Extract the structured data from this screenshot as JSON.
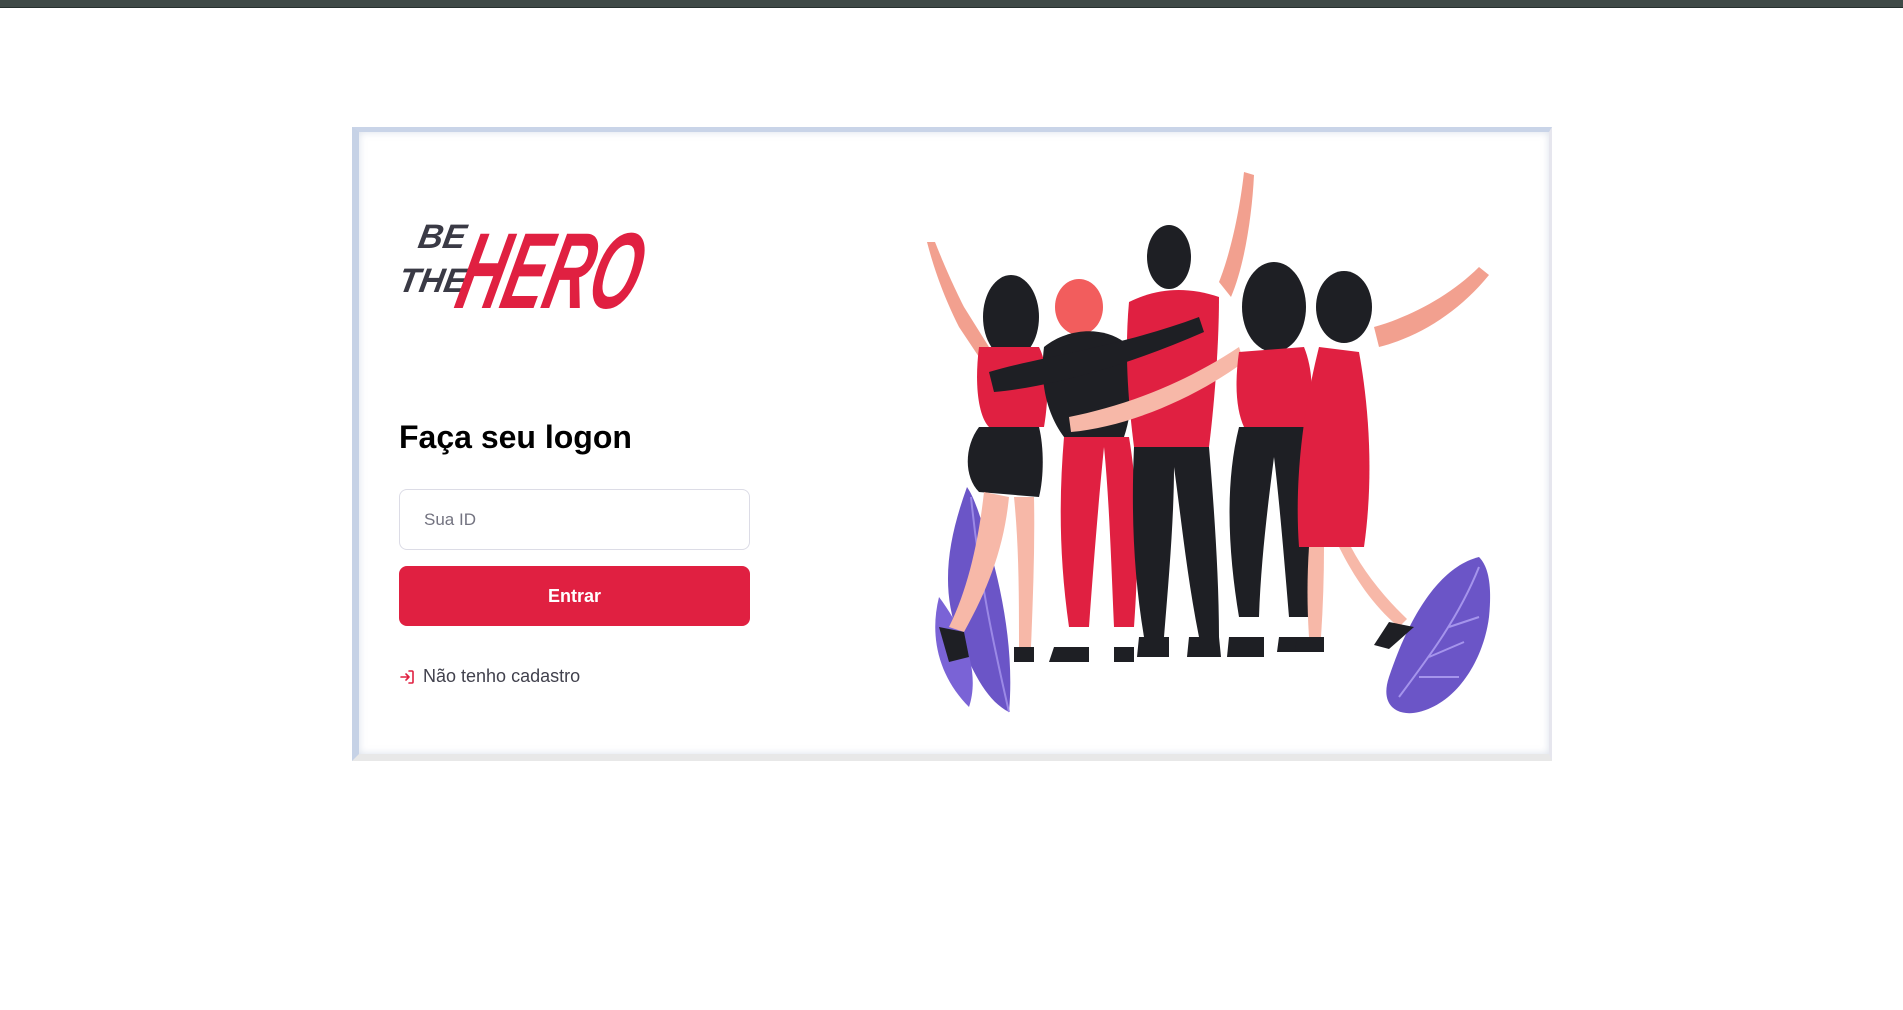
{
  "brand": {
    "logo_top": "BE",
    "logo_mid": "THE",
    "logo_main": "HERO",
    "accent": "#e02041",
    "dark": "#3a3a45"
  },
  "login": {
    "title": "Faça seu logon",
    "id_placeholder": "Sua ID",
    "id_value": "",
    "submit_label": "Entrar",
    "register_link": "Não tenho cadastro",
    "register_icon": "log-in-icon"
  },
  "illustration": {
    "name": "heroes-group-illustration"
  }
}
